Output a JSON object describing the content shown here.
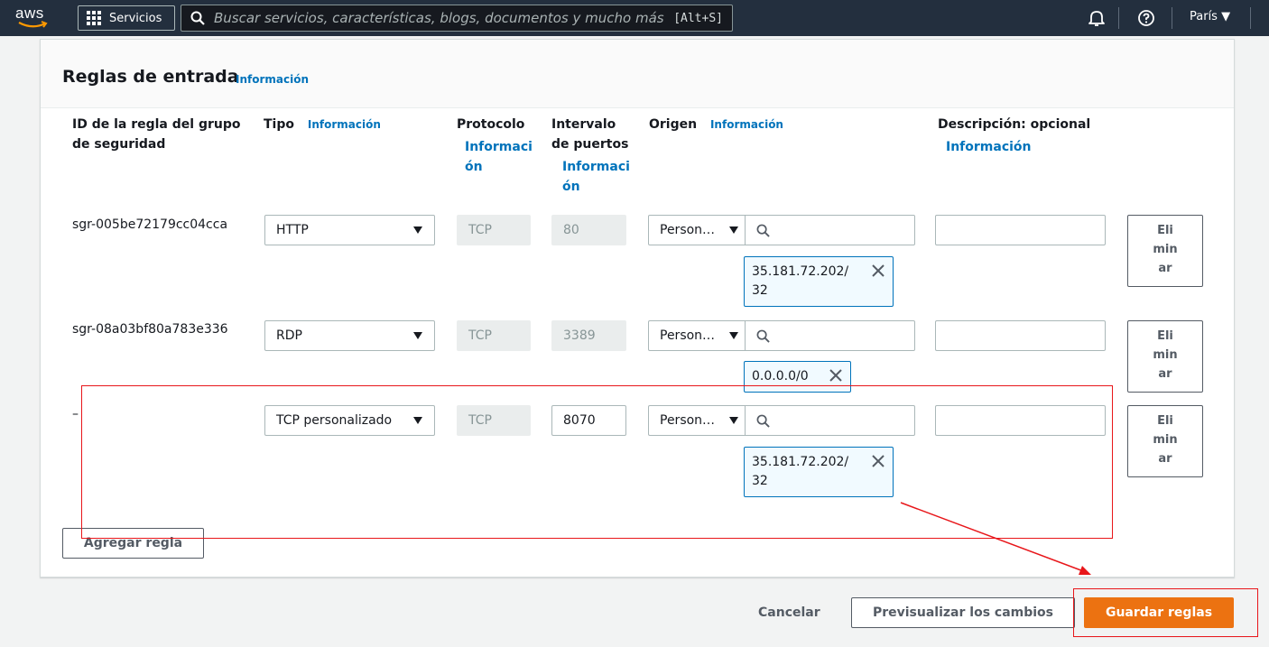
{
  "topnav": {
    "logo": "aws",
    "services_label": "Servicios",
    "search_placeholder": "Buscar servicios, características, blogs, documentos y mucho más",
    "search_shortcut": "[Alt+S]",
    "region": "París ▼",
    "icons": [
      "grid-icon",
      "search-icon",
      "bell-icon",
      "help-icon"
    ]
  },
  "panel": {
    "title": "Reglas de entrada",
    "info": "Información",
    "columns": {
      "rule_id": "ID de la regla del grupo de seguridad",
      "type": "Tipo",
      "type_info": "Información",
      "protocol": "Protocolo",
      "protocol_info": "Informaci ón",
      "port_range": "Intervalo de puertos",
      "port_info": "Informaci ón",
      "origin": "Origen",
      "origin_info": "Información",
      "description": "Descripción: opcional",
      "description_info": "Información"
    },
    "rules": [
      {
        "id": "sgr-005be72179cc04cca",
        "type": "HTTP",
        "protocol": "TCP",
        "port": "80",
        "origin": "Person…",
        "token": "35.181.72.202/ 32",
        "description": "",
        "delete": "Eli min ar"
      },
      {
        "id": "sgr-08a03bf80a783e336",
        "type": "RDP",
        "protocol": "TCP",
        "port": "3389",
        "origin": "Person…",
        "token": "0.0.0.0/0",
        "description": "",
        "delete": "Eli min ar"
      },
      {
        "id": "–",
        "type": "TCP personalizado",
        "protocol": "TCP",
        "port": "8070",
        "origin": "Person…",
        "token": "35.181.72.202/ 32",
        "description": "",
        "delete": "Eli min ar"
      }
    ],
    "add_rule": "Agregar regla"
  },
  "footer": {
    "cancel": "Cancelar",
    "preview": "Previsualizar los cambios",
    "save": "Guardar reglas"
  },
  "colors": {
    "nav_bg": "#232f3e",
    "info_link": "#0073bb",
    "primary_button": "#ec7211",
    "annotation": "#e8161a"
  }
}
